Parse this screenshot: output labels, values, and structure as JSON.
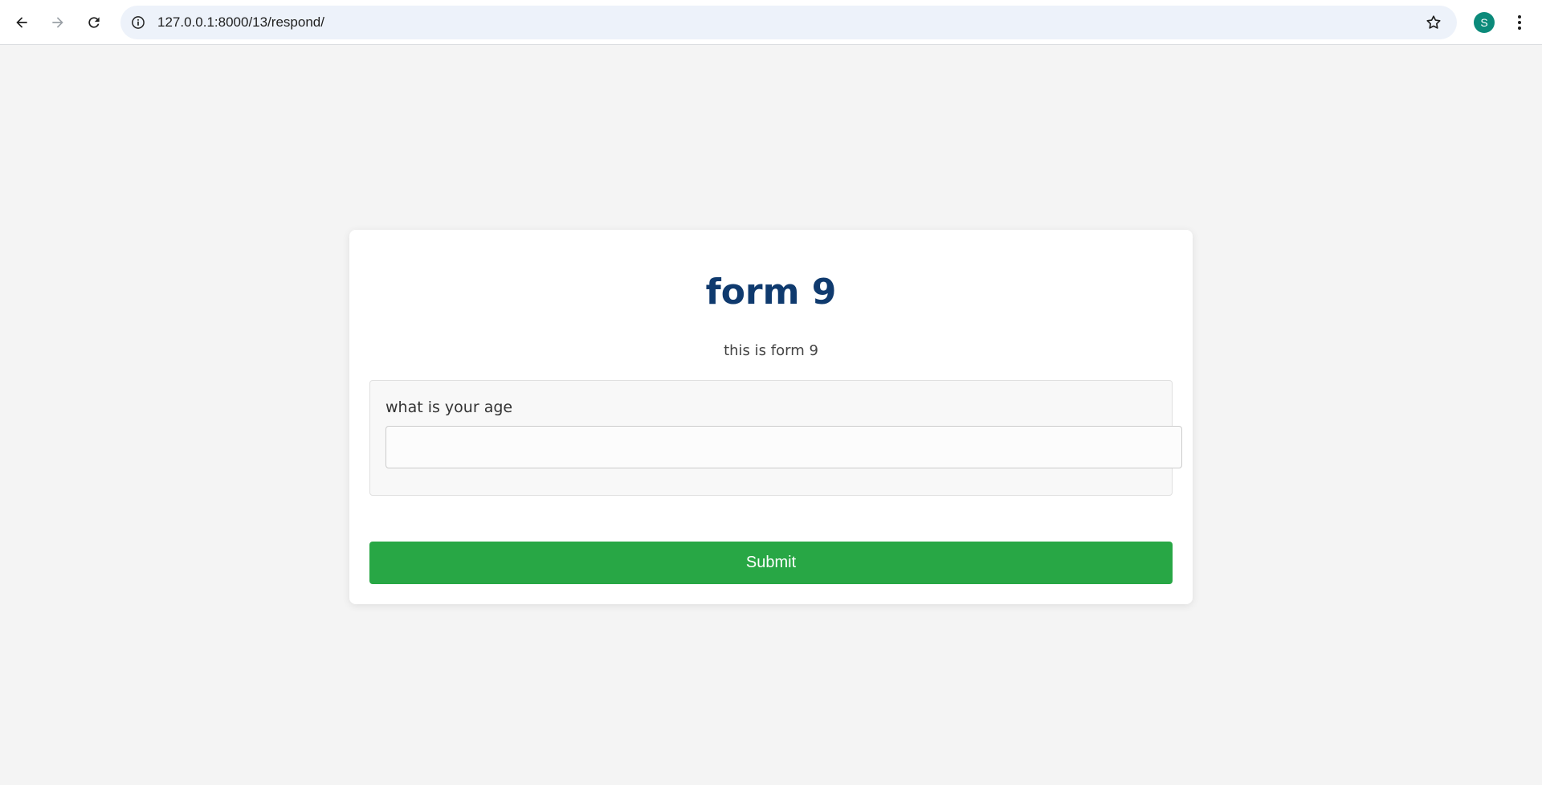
{
  "browser": {
    "url": "127.0.0.1:8000/13/respond/",
    "profile_initial": "S",
    "profile_color": "#0b8a7a",
    "icons": {
      "back": "arrow-left-icon",
      "forward": "arrow-right-icon",
      "reload": "reload-icon",
      "site_info": "info-icon",
      "bookmark": "star-icon",
      "menu": "kebab-menu-icon"
    }
  },
  "form": {
    "title": "form 9",
    "description": "this is form 9",
    "questions": [
      {
        "label": "what is your age",
        "value": ""
      }
    ],
    "submit_label": "Submit"
  },
  "colors": {
    "title": "#0f3a6e",
    "submit": "#28a745",
    "page_bg": "#f4f4f4"
  }
}
